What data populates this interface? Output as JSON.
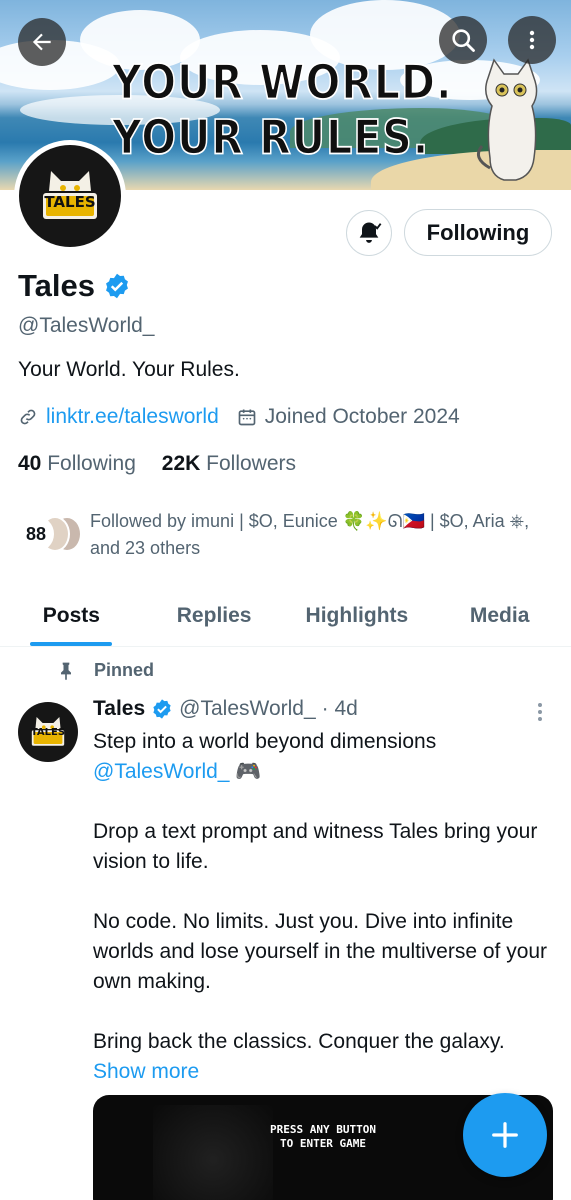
{
  "banner": {
    "headline": "YOUR WORLD. YOUR RULES."
  },
  "profile": {
    "avatar_text": "TALES",
    "name": "Tales",
    "handle": "@TalesWorld_",
    "bio": "Your World. Your Rules.",
    "link": "linktr.ee/talesworld",
    "joined": "Joined October 2024",
    "following_count": "40",
    "following_label": "Following",
    "followers_count": "22K",
    "followers_label": "Followers",
    "follow_button_label": "Following",
    "followed_by_count": "88",
    "followed_by_text": "Followed by imuni | $O, Eunice 🍀✨ᘏ🇵🇭 | $O, Aria ⎈, and 23 others"
  },
  "tabs": [
    {
      "label": "Posts",
      "active": true
    },
    {
      "label": "Replies",
      "active": false
    },
    {
      "label": "Highlights",
      "active": false
    },
    {
      "label": "Media",
      "active": false
    }
  ],
  "pinned_post": {
    "pinned_label": "Pinned",
    "author_name": "Tales",
    "author_handle": "@TalesWorld_",
    "time": "· 4d",
    "line1": "Step into a world beyond dimensions",
    "mention": "@TalesWorld_",
    "emoji": "🎮",
    "para2": "Drop a text prompt and witness Tales bring your vision to life.",
    "para3": "No code. No limits. Just you. Dive into infinite worlds and lose yourself in the multiverse of your own making.",
    "para4": "Bring back the classics. Conquer the galaxy.",
    "show_more": "Show more",
    "media_text_line1": "PRESS ANY BUTTON",
    "media_text_line2": "TO ENTER GAME"
  },
  "colors": {
    "accent": "#1d9bf0",
    "text": "#0f1419",
    "muted": "#536471"
  },
  "icons": [
    "back-arrow-icon",
    "search-icon",
    "more-vertical-icon",
    "bell-icon",
    "verified-badge-icon",
    "link-icon",
    "calendar-icon",
    "pin-icon",
    "plus-icon"
  ]
}
